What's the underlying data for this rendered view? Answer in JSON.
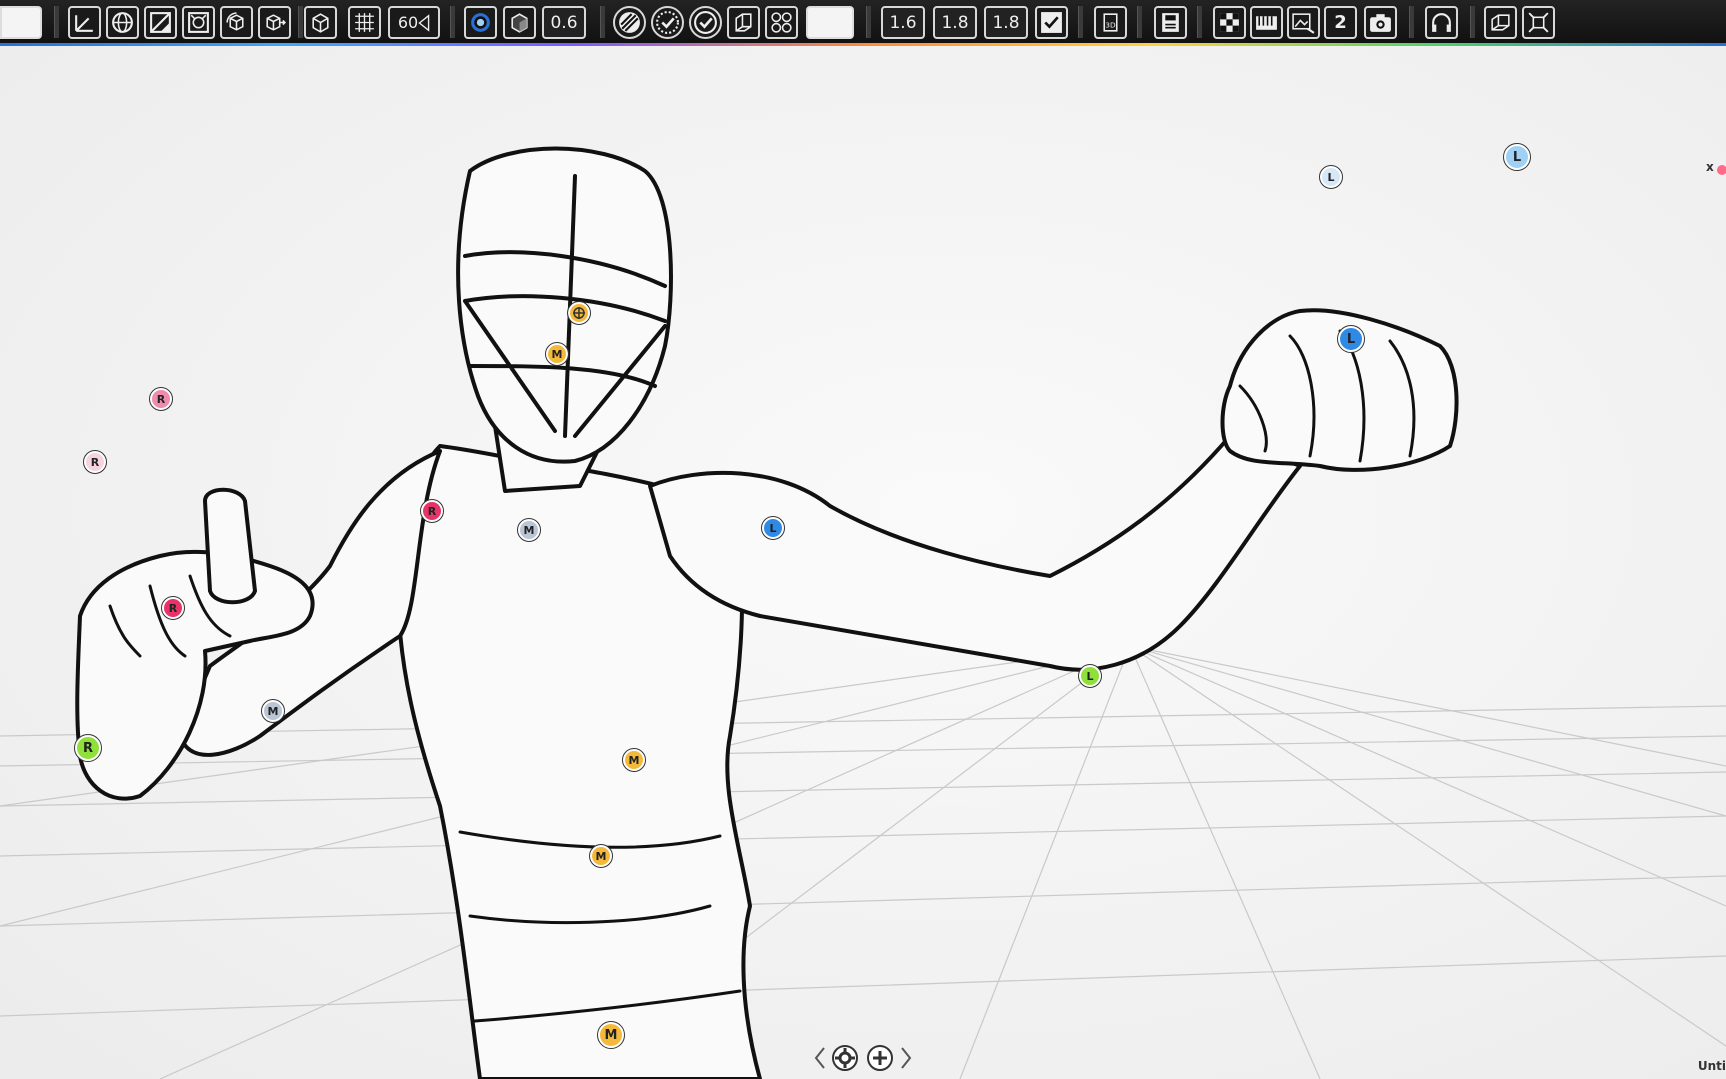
{
  "toolbar": {
    "fov_value": "60",
    "opacity_value": "0.6",
    "line_widths": [
      "1.6",
      "1.8",
      "1.8"
    ],
    "camera_slot": "2",
    "view_3d_label": "3D",
    "buttons": [
      {
        "name": "axis-gizmo-icon"
      },
      {
        "name": "sphere-grid-icon"
      },
      {
        "name": "perspective-icon"
      },
      {
        "name": "camera-frame-icon"
      },
      {
        "name": "cube-rotate-icon"
      },
      {
        "name": "cube-move-icon"
      },
      {
        "name": "box-icon"
      },
      {
        "name": "floor-grid-icon"
      }
    ]
  },
  "viewport": {
    "close_label": "x",
    "doc_name": "Unti"
  },
  "handles": [
    {
      "label": "R",
      "color": "#f08cab",
      "size": "normal"
    },
    {
      "label": "R",
      "color": "#f6d4de",
      "size": "normal"
    },
    {
      "label": "R",
      "color": "#e8336a",
      "size": "normal"
    },
    {
      "label": "R",
      "color": "#e8336a",
      "size": "normal"
    },
    {
      "label": "R",
      "color": "#8fe03a",
      "size": "big"
    },
    {
      "label": "M",
      "color": "#b8c6d6",
      "size": "normal"
    },
    {
      "label": "M",
      "color": "#b8c6d6",
      "size": "normal"
    },
    {
      "label": "M",
      "color": "#f4b93a",
      "size": "normal"
    },
    {
      "label": "M",
      "color": "#f4b93a",
      "size": "normal"
    },
    {
      "label": "M",
      "color": "#f4b93a",
      "size": "normal"
    },
    {
      "label": "M",
      "color": "#f4b93a",
      "size": "big"
    },
    {
      "label": "",
      "color": "#f4b93a",
      "size": "normal"
    },
    {
      "label": "L",
      "color": "#2f8ae6",
      "size": "normal"
    },
    {
      "label": "L",
      "color": "#2f8ae6",
      "size": "big"
    },
    {
      "label": "L",
      "color": "#8fe03a",
      "size": "normal"
    },
    {
      "label": "L",
      "color": "#d6e8f8",
      "size": "normal"
    },
    {
      "label": "L",
      "color": "#9fd0f6",
      "size": "big"
    }
  ]
}
